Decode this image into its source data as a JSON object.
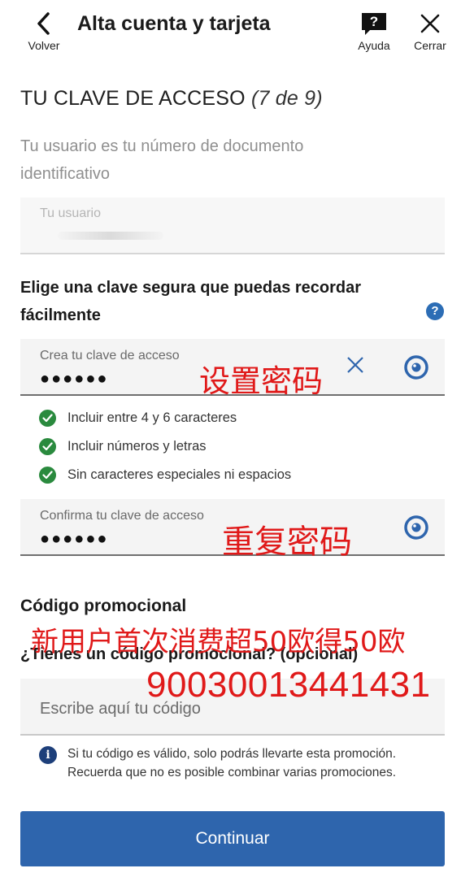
{
  "header": {
    "back_label": "Volver",
    "title": "Alta cuenta y tarjeta",
    "help_label": "Ayuda",
    "close_label": "Cerrar"
  },
  "step": {
    "title": "TU CLAVE DE ACCESO",
    "count": "(7 de 9)"
  },
  "username_hint": "Tu usuario es tu número de documento identificativo",
  "username_field": {
    "label": "Tu usuario"
  },
  "password_section": {
    "title": "Elige una clave segura que puedas recordar fácilmente",
    "info_icon": "?",
    "create": {
      "label": "Crea tu clave de acceso",
      "value": "●●●●●●"
    },
    "rules": [
      {
        "text": "Incluir entre 4 y 6 caracteres",
        "icon": "check-circle-icon"
      },
      {
        "text": "Incluir números y letras",
        "icon": "check-circle-icon"
      },
      {
        "text": "Sin caracteres especiales ni espacios",
        "icon": "check-circle-icon"
      }
    ],
    "confirm": {
      "label": "Confirma tu clave de acceso",
      "value": "●●●●●●"
    }
  },
  "promo": {
    "title": "Código promocional",
    "subtitle": "¿Tienes un código promocional? (opcional)",
    "placeholder": "Escribe aquí tu código",
    "note": "Si tu código es válido, solo podrás llevarte esta promoción. Recuerda que no es posible combinar varias promociones."
  },
  "overlays": {
    "password_annotation": "设置密码",
    "confirm_annotation": "重复密码",
    "promo_annotation": "新用户首次消费超50欧得50欧",
    "promo_code_annotation": "90030013441431"
  },
  "continue_label": "Continuar",
  "colors": {
    "primary": "#2e65ad",
    "success": "#2a8a3e",
    "annotation_red": "#e01919",
    "info_dark": "#1d3f7a"
  }
}
